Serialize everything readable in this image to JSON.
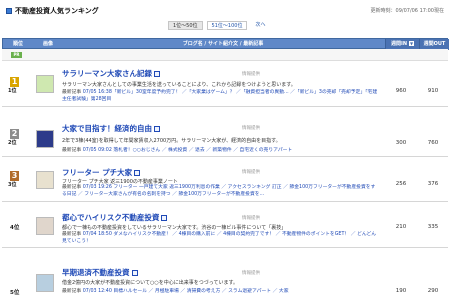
{
  "header": {
    "title": "不動産投資人気ランキング",
    "updated": "更新時刻：09/07/06 17:00現在"
  },
  "pager": {
    "items": [
      "1位〜50位",
      "51位〜100位"
    ],
    "next": "次へ"
  },
  "columns": {
    "rank": "順位",
    "image": "画像",
    "blog": "ブログ名 / サイト紹介文 / 最新記事",
    "in": "週間IN",
    "out": "週間OUT"
  },
  "pr_label": "PR",
  "colors": {
    "header_bg": "#5f88c8",
    "in_out_bg": "#4a72b3",
    "title_link": "#1f49b6",
    "rank1": "#d9a400",
    "rank2": "#8c8c8c",
    "rank3": "#b06b2a",
    "pr_green": "#6ab04c"
  },
  "rows": [
    {
      "rank_label": "1位",
      "rank_icon": "1",
      "title": "サラリーマン大家さん記録",
      "category": "情報提供",
      "desc": "サラリーマン大家さんとしての事業生活を送っていることにより、これから記録をつけようと思います。",
      "latest_label": "最新記事",
      "latest": "07/05 16:38「新ビル」30室年度予約完了！ ／「大家業はゲーム」？ ／「融資担当者の異動... ／「新ビル」3の売却「売却予定」「宅建主任者試験」第28回目",
      "in": "960",
      "out": "910"
    },
    {
      "rank_label": "2位",
      "rank_icon": "2",
      "title": "大家で目指す！経済的自由",
      "category": "情報提供",
      "desc": "2年で3棟(44室)を取得して年間家賃収入2700万円。サラリーマン大家が、経済的自由を目指す。",
      "latest_label": "最新記事",
      "latest": "07/05 09:02 落札者！○○おじさん ／ 株式投資 ／ 退去 ／ 新築物件 ／ 自宅近くの売りアパート",
      "in": "300",
      "out": "760"
    },
    {
      "rank_label": "3位",
      "rank_icon": "3",
      "title": "フリーター プチ大家",
      "category": "情報提供",
      "desc": "フリーター プチ大家 返三1900の不動産事業ノート",
      "latest_label": "最新記事",
      "latest": "07/03 19:26 フリーター 一戸建て大家 返三1900万利息の作業 ／ アクセスランキング 訂正 ／ 節金100万フリーターが不動産投資をする日記 ／ フリーター大家さんが有名の名刺を持つ ／ 節金100万フリーターが不動産投資を...",
      "in": "256",
      "out": "376"
    },
    {
      "rank_label": "4位",
      "rank_icon": "",
      "title": "都心でハイリスク不動産投資",
      "category": "情報提供",
      "desc": "都心で一棟もの不動産投資をしているサラリーマン大家です。渋谷の一棟ビル事件について「裏技」",
      "latest_label": "最新記事",
      "latest": "07/04 18:50 ダメなハイリスク不動産！ ／ 4棟目の購入前に ／ 4棟目の契約完了です！ ／ 不動産物件のポイントをGET！ ／ どんどん見ていこう！",
      "in": "210",
      "out": "335"
    },
    {
      "rank_label": "5位",
      "rank_icon": "",
      "title": "早期退済不動産投資",
      "category": "情報提供",
      "desc": "借金2億円の大家が不動産投資について○○を中心に出来事をつづっています。",
      "latest_label": "最新記事",
      "latest": "07/03 12:40 目標ハルセール ／ 月極駐車場 ／ 清掃費の考え方 ／ スラム退避アパート ／ 大家",
      "in": "190",
      "out": "290"
    }
  ]
}
